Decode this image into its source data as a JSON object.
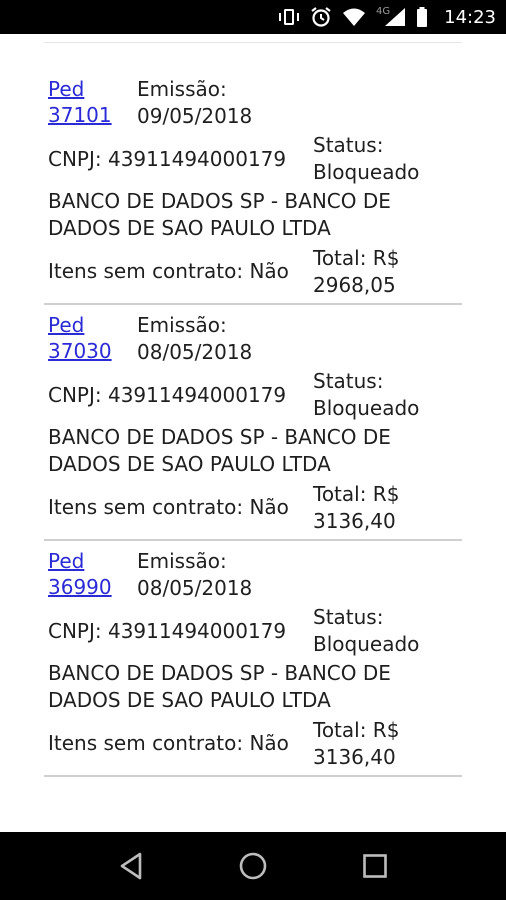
{
  "status_bar": {
    "network_type": "4G",
    "time": "14:23",
    "icons": [
      "vibrate-icon",
      "alarm-icon",
      "wifi-icon",
      "signal-icon",
      "battery-icon"
    ]
  },
  "orders": [
    {
      "ped_label": "Ped",
      "ped_number": "37101",
      "emissao_label": "Emissão:",
      "emissao_date": "09/05/2018",
      "cnpj": "CNPJ: 43911494000179",
      "status_label": "Status:",
      "status_value": "Bloqueado",
      "company_line1": "BANCO DE DADOS SP - BANCO DE",
      "company_line2": "DADOS DE SAO PAULO LTDA",
      "itens": "Itens sem contrato: Não",
      "total_label": "Total: R$",
      "total_value": "2968,05"
    },
    {
      "ped_label": "Ped",
      "ped_number": "37030",
      "emissao_label": "Emissão:",
      "emissao_date": "08/05/2018",
      "cnpj": "CNPJ: 43911494000179",
      "status_label": "Status:",
      "status_value": "Bloqueado",
      "company_line1": "BANCO DE DADOS SP - BANCO DE",
      "company_line2": "DADOS DE SAO PAULO LTDA",
      "itens": "Itens sem contrato: Não",
      "total_label": "Total: R$",
      "total_value": "3136,40"
    },
    {
      "ped_label": "Ped",
      "ped_number": "36990",
      "emissao_label": "Emissão:",
      "emissao_date": "08/05/2018",
      "cnpj": "CNPJ: 43911494000179",
      "status_label": "Status:",
      "status_value": "Bloqueado",
      "company_line1": "BANCO DE DADOS SP - BANCO DE",
      "company_line2": "DADOS DE SAO PAULO LTDA",
      "itens": "Itens sem contrato: Não",
      "total_label": "Total: R$",
      "total_value": "3136,40"
    }
  ],
  "nav_bar": {
    "buttons": [
      "back-icon",
      "home-icon",
      "recents-icon"
    ]
  }
}
